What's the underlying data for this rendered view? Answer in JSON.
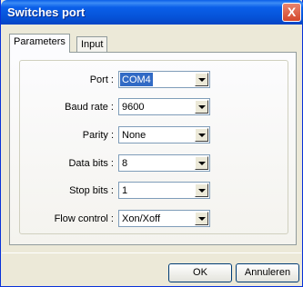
{
  "window": {
    "title": "Switches port",
    "close_label": "X"
  },
  "tabs": [
    {
      "label": "Parameters",
      "active": true
    },
    {
      "label": "Input",
      "active": false
    }
  ],
  "fields": [
    {
      "label": "Port :",
      "value": "COM4"
    },
    {
      "label": "Baud rate :",
      "value": "9600"
    },
    {
      "label": "Parity :",
      "value": "None"
    },
    {
      "label": "Data bits :",
      "value": "8"
    },
    {
      "label": "Stop bits :",
      "value": "1"
    },
    {
      "label": "Flow control :",
      "value": "Xon/Xoff"
    }
  ],
  "buttons": {
    "ok": "OK",
    "cancel": "Annuleren"
  },
  "colors": {
    "title_bar": "#0a5fe9",
    "selection": "#316ac5",
    "close": "#d4472b"
  }
}
